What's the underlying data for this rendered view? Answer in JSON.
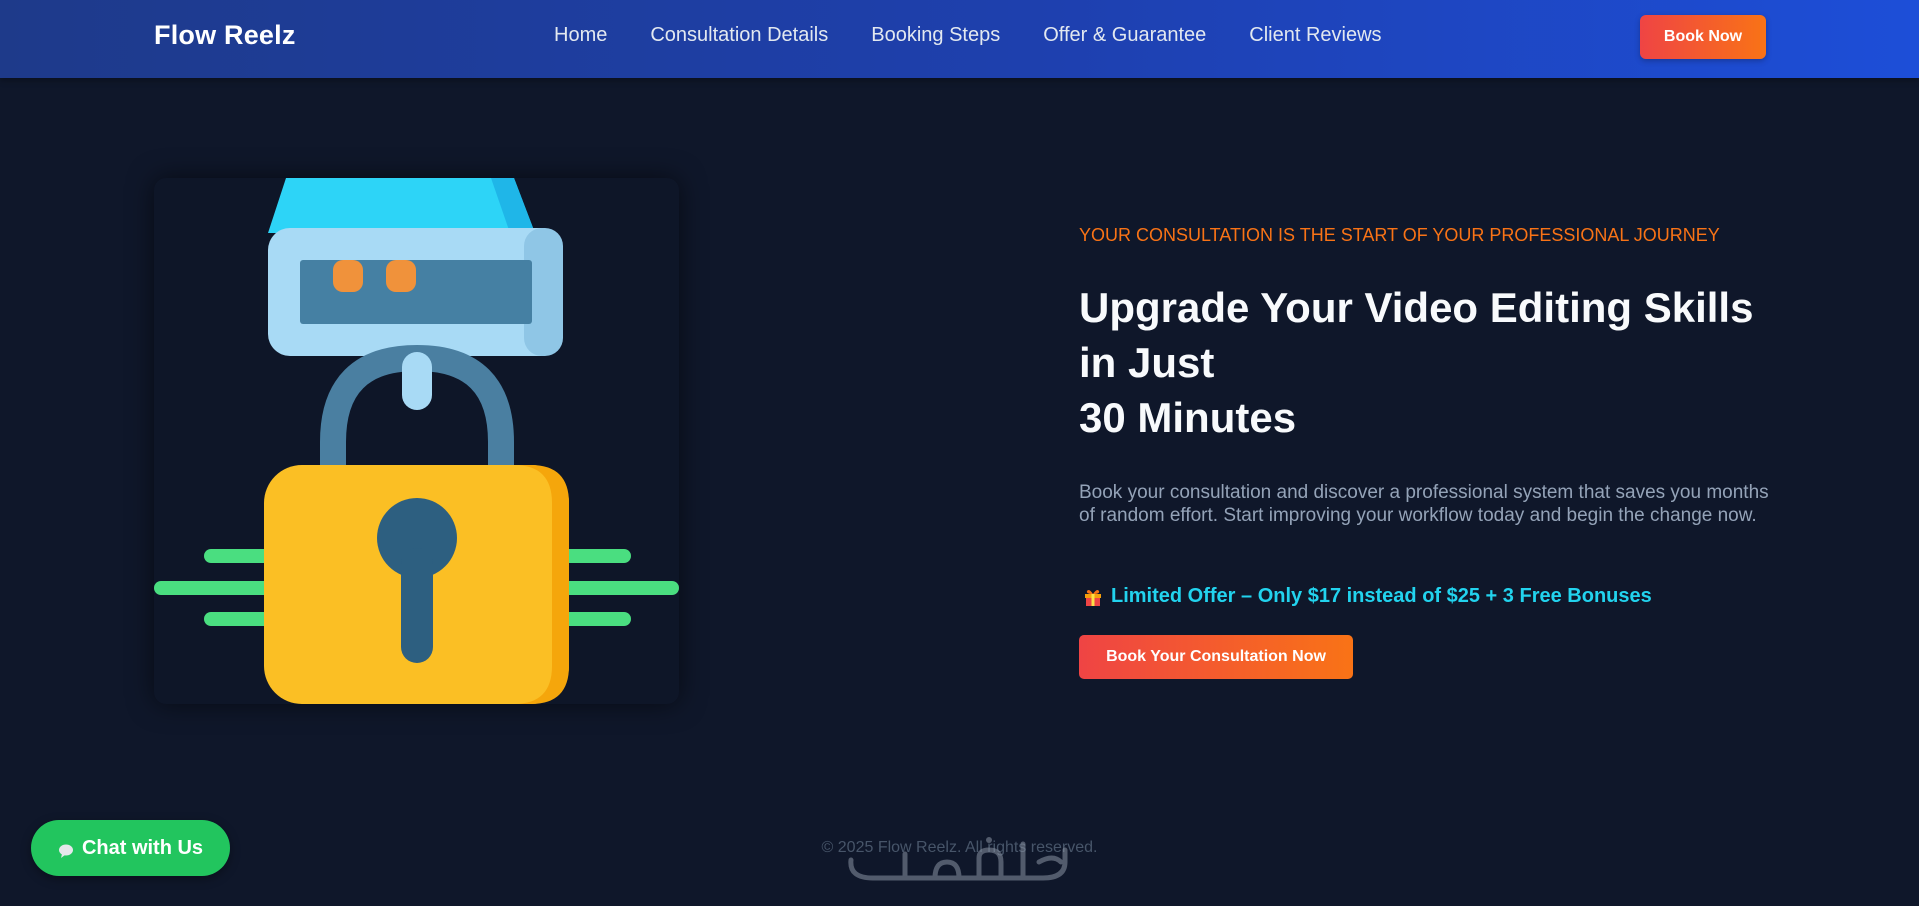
{
  "header": {
    "brand": "Flow Reelz",
    "nav": [
      "Home",
      "Consultation Details",
      "Booking Steps",
      "Offer & Guarantee",
      "Client Reviews"
    ],
    "cta_label": "Book Now"
  },
  "hero": {
    "eyebrow": "YOUR CONSULTATION IS THE START OF YOUR PROFESSIONAL JOURNEY",
    "headline_line1": "Upgrade Your Video Editing Skills",
    "headline_line2": "in Just",
    "headline_line3": "30 Minutes",
    "description": "Book your consultation and discover a professional system that saves you months of random effort. Start improving your workflow today and begin the change now.",
    "offer_icon": "gift-icon",
    "offer_text": "Limited Offer – Only $17 instead of $25 + 3 Free Bonuses",
    "cta_label": "Book Your Consultation Now",
    "illustration": "padlock-with-storage-drive-illustration"
  },
  "chat": {
    "icon": "speech-bubble-icon",
    "label": "Chat with Us"
  },
  "footer": {
    "copyright": "© 2025 Flow Reelz. All rights reserved."
  },
  "watermark": {
    "logo": "khamsat-logo-watermark",
    "text": "خمسات"
  },
  "colors": {
    "background": "#0f172a",
    "header_start": "#1e3a8a",
    "header_end": "#1d4ed8",
    "accent_orange": "#f97316",
    "accent_red": "#ef4444",
    "offer_cyan": "#22d3ee",
    "chat_green": "#22c55e",
    "lock_yellow": "#fbbf24",
    "drive_blue": "#38bdf8"
  }
}
